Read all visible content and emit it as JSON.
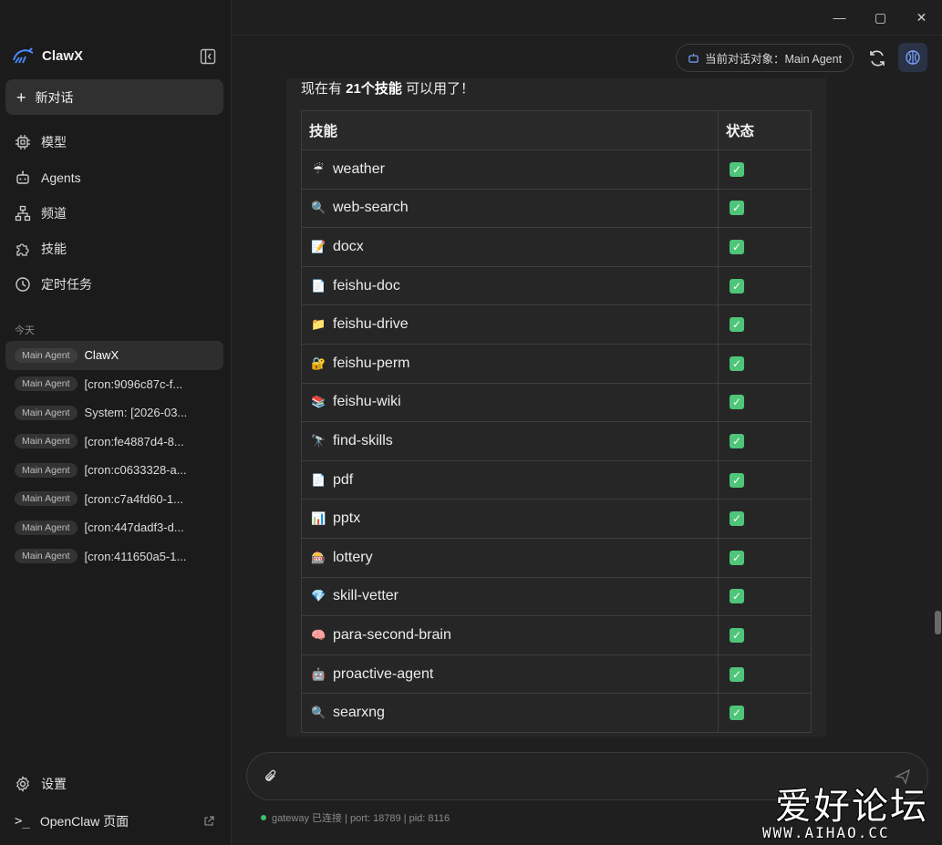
{
  "window": {
    "minimize": "—",
    "maximize": "▢",
    "close": "✕"
  },
  "sidebar": {
    "brand": "ClawX",
    "new_chat": "新对话",
    "nav": [
      {
        "label": "模型",
        "icon": "chip-icon"
      },
      {
        "label": "Agents",
        "icon": "bot-icon"
      },
      {
        "label": "频道",
        "icon": "network-icon"
      },
      {
        "label": "技能",
        "icon": "puzzle-icon"
      },
      {
        "label": "定时任务",
        "icon": "clock-icon"
      }
    ],
    "section_today": "今天",
    "sessions": [
      {
        "agent": "Main Agent",
        "title": "ClawX",
        "active": true
      },
      {
        "agent": "Main Agent",
        "title": "[cron:9096c87c-f..."
      },
      {
        "agent": "Main Agent",
        "title": "System: [2026-03..."
      },
      {
        "agent": "Main Agent",
        "title": "[cron:fe4887d4-8..."
      },
      {
        "agent": "Main Agent",
        "title": "[cron:c0633328-a..."
      },
      {
        "agent": "Main Agent",
        "title": "[cron:c7a4fd60-1..."
      },
      {
        "agent": "Main Agent",
        "title": "[cron:447dadf3-d..."
      },
      {
        "agent": "Main Agent",
        "title": "[cron:411650a5-1..."
      }
    ],
    "settings": "设置",
    "openclaw": "OpenClaw 页面"
  },
  "header": {
    "agent_pill": "当前对话对象：Main Agent"
  },
  "message": {
    "intro_prefix": "现在有 ",
    "intro_bold": "21个技能",
    "intro_suffix": " 可以用了！",
    "table_headers": [
      "技能",
      "状态"
    ],
    "rows": [
      {
        "icon": "☔",
        "name": "weather",
        "status": "✓"
      },
      {
        "icon": "🔍",
        "name": "web-search",
        "status": "✓"
      },
      {
        "icon": "📝",
        "name": "docx",
        "status": "✓"
      },
      {
        "icon": "📄",
        "name": "feishu-doc",
        "status": "✓"
      },
      {
        "icon": "📁",
        "name": "feishu-drive",
        "status": "✓"
      },
      {
        "icon": "🔐",
        "name": "feishu-perm",
        "status": "✓"
      },
      {
        "icon": "📚",
        "name": "feishu-wiki",
        "status": "✓"
      },
      {
        "icon": "🔭",
        "name": "find-skills",
        "status": "✓"
      },
      {
        "icon": "📄",
        "name": "pdf",
        "status": "✓"
      },
      {
        "icon": "📊",
        "name": "pptx",
        "status": "✓"
      },
      {
        "icon": "🎰",
        "name": "lottery",
        "status": "✓"
      },
      {
        "icon": "💎",
        "name": "skill-vetter",
        "status": "✓"
      },
      {
        "icon": "🧠",
        "name": "para-second-brain",
        "status": "✓"
      },
      {
        "icon": "🤖",
        "name": "proactive-agent",
        "status": "✓"
      },
      {
        "icon": "🔍",
        "name": "searxng",
        "status": "✓"
      }
    ]
  },
  "composer": {
    "placeholder": ""
  },
  "status_bar": "gateway 已连接 | port: 18789 | pid: 8116",
  "watermark": {
    "cn": "爱好论坛",
    "en": "WWW.AIHAO.CC"
  },
  "colors": {
    "accent": "#4fc57a",
    "background": "#1f1f1f",
    "sidebar": "#1b1b1b",
    "brain_button": "#2a3246"
  }
}
